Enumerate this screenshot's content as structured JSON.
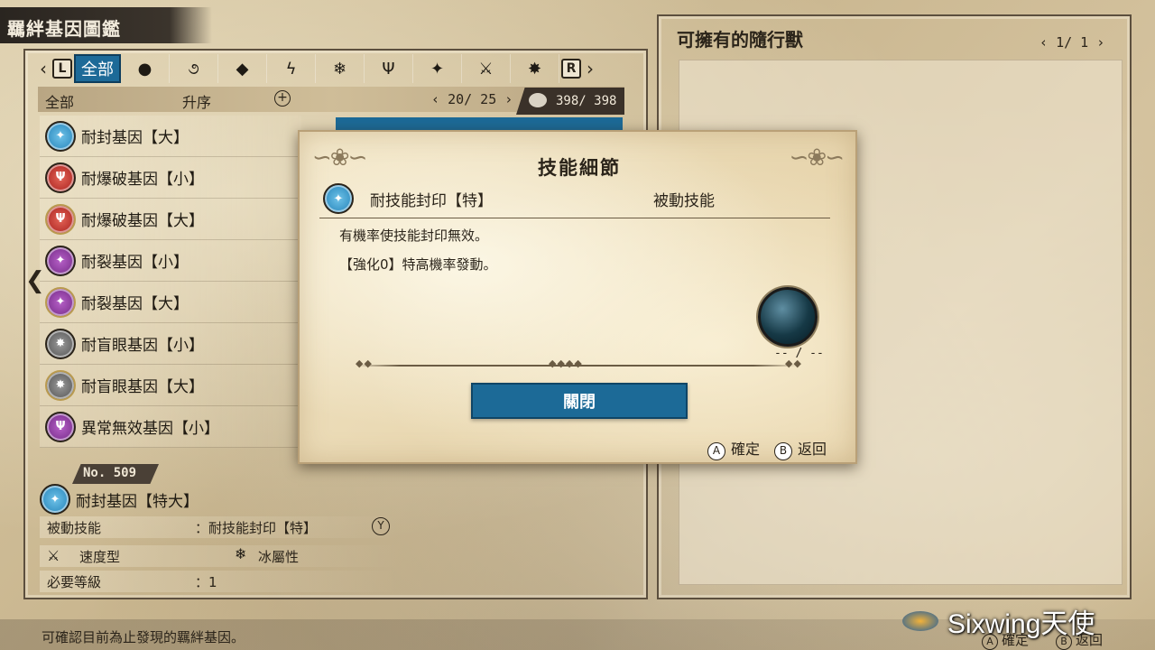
{
  "window_title": "羈絆基因圖鑑",
  "tabs": {
    "left_button": "L",
    "right_button": "R",
    "items": [
      {
        "label": "全部",
        "icon": "all-tab",
        "active": true
      },
      {
        "label": "●",
        "icon": "non-element-icon"
      },
      {
        "label": "૭",
        "icon": "fire-icon"
      },
      {
        "label": "◆",
        "icon": "water-icon"
      },
      {
        "label": "ϟ",
        "icon": "thunder-icon"
      },
      {
        "label": "❄",
        "icon": "ice-icon"
      },
      {
        "label": "Ψ",
        "icon": "dragon-icon"
      },
      {
        "label": "✦",
        "icon": "power-icon"
      },
      {
        "label": "⚔",
        "icon": "speed-icon"
      },
      {
        "label": "✸",
        "icon": "technical-icon"
      }
    ]
  },
  "filter": {
    "category": "全部",
    "sort": "升序",
    "add_symbol": "+",
    "page": "20/ 25"
  },
  "count": "398/ 398",
  "genes": [
    {
      "label": "耐封基因【大】",
      "color": "blue"
    },
    {
      "label": "耐爆破基因【小】",
      "color": "red"
    },
    {
      "label": "耐爆破基因【大】",
      "color": "red"
    },
    {
      "label": "耐裂基因【小】",
      "color": "purple"
    },
    {
      "label": "耐裂基因【大】",
      "color": "purple"
    },
    {
      "label": "耐盲眼基因【小】",
      "color": "gray"
    },
    {
      "label": "耐盲眼基因【大】",
      "color": "gray"
    },
    {
      "label": "異常無效基因【小】",
      "color": "purple"
    }
  ],
  "detail": {
    "number": "No. 509",
    "name": "耐封基因【特大】",
    "skill_key": "被動技能",
    "skill_value": "：耐技能封印【特】",
    "y_button": "Y",
    "type_label": "速度型",
    "element_label": "冰屬性",
    "level_key": "必要等級",
    "level_value": "：1"
  },
  "right_panel": {
    "title": "可擁有的隨行獸",
    "page": "1/ 1"
  },
  "dialog": {
    "title": "技能細節",
    "skill_name": "耐技能封印【特】",
    "skill_type": "被動技能",
    "desc_line1": "有機率使技能封印無效。",
    "desc_line2": "【強化0】特高機率發動。",
    "orb_label": "-- / --",
    "close_label": "關閉",
    "confirm_button": "A",
    "confirm_label": "確定",
    "back_button": "B",
    "back_label": "返回"
  },
  "bottom": {
    "hint": "可確認目前為止發現的羈絆基因。",
    "confirm_button": "A",
    "confirm_label": "確定",
    "back_button": "B",
    "back_label": "返回"
  },
  "watermark": "Sixwing天使",
  "colors": {
    "accent_blue": "#1c6a97",
    "parchment": "#d8c8a4",
    "dark": "#2b241a"
  }
}
